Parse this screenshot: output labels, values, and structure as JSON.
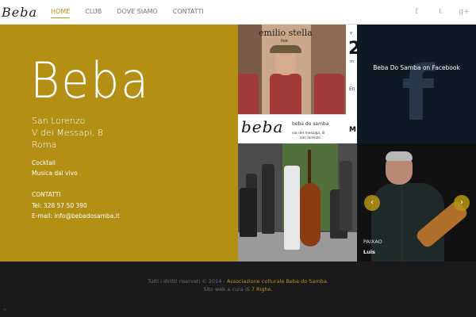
{
  "header": {
    "logo": "Beba",
    "nav": [
      {
        "label": "HOME",
        "active": true
      },
      {
        "label": "CLUB",
        "active": false
      },
      {
        "label": "DOVE SIAMO",
        "active": false
      },
      {
        "label": "CONTATTI",
        "active": false
      }
    ],
    "social": [
      {
        "icon": "facebook-icon",
        "glyph": "f"
      },
      {
        "icon": "twitter-icon",
        "glyph": "t"
      },
      {
        "icon": "google-plus-icon",
        "glyph": "g+"
      }
    ]
  },
  "info": {
    "brand": "Beba",
    "address": [
      "San Lorenzo",
      "V dei Messapi, 8",
      "Roma"
    ],
    "services": [
      "Cocktail",
      "Musica dal vivo"
    ],
    "contacts_heading": "CONTATTI",
    "phone": "Tel: 328 57 50 390",
    "email": "E-mail: info@bebadosamba.it"
  },
  "poster": {
    "title": "emilio stella",
    "live": "live",
    "side_top": "v",
    "side_big": "2",
    "side_m": "m",
    "side_en": "En",
    "side_bottom": "M",
    "logo": "beba",
    "venue": "beba do samba",
    "address_line1": "via dei messapi, 8",
    "address_line2": "san lorenzo"
  },
  "facebook": {
    "label": "Beba Do Samba on Facebook",
    "glyph": "f"
  },
  "slider": {
    "caption_line1": "PAIXAO",
    "caption_line2": "Luis",
    "prev": "‹",
    "next": "›"
  },
  "footer": {
    "line1_text": "Tutti i diritti riservati © 2014 - ",
    "line1_link": "Associazione culturale Beba do Samba.",
    "line2_text": "Sito web a cura di ",
    "line2_link": "7 Righe.",
    "scroll_top": "^"
  },
  "colors": {
    "gold": "#b38f14",
    "accent": "#b79412",
    "footer_bg": "#1a1a1a",
    "facebook_bg": "#0d1a26"
  }
}
